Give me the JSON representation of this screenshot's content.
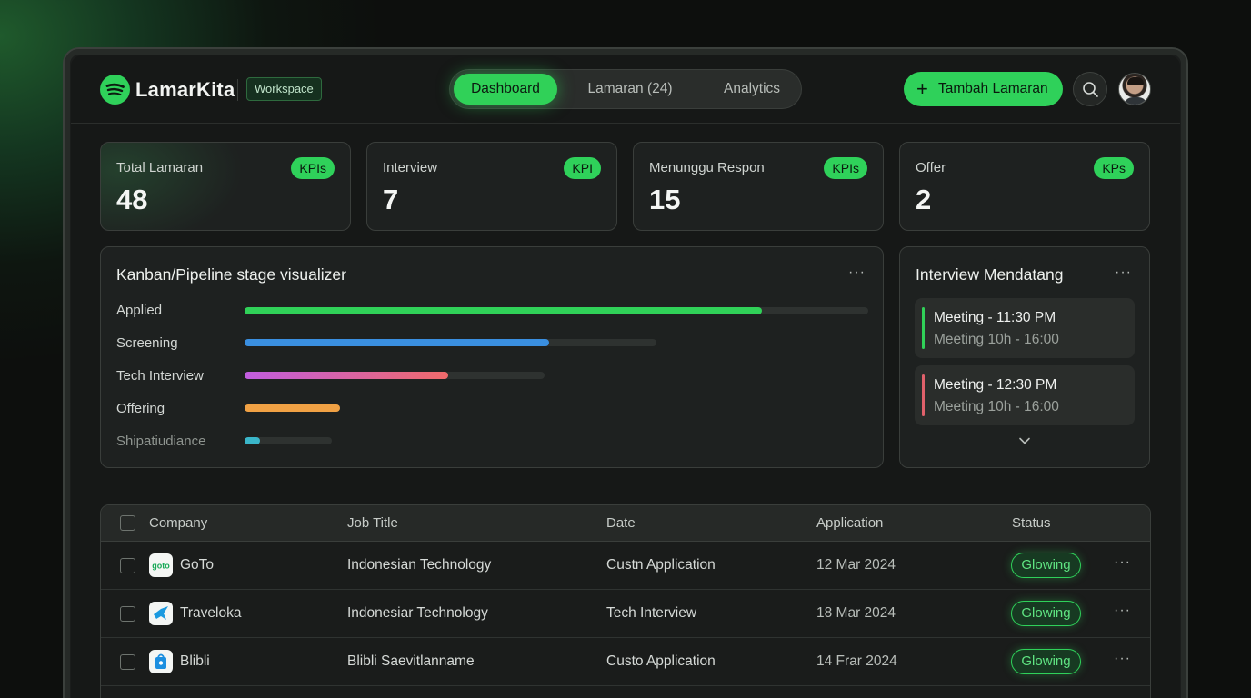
{
  "app": {
    "brand": "LamarKita",
    "workspace_badge": "Workspace"
  },
  "nav": {
    "tabs": [
      {
        "label": "Dashboard",
        "active": true
      },
      {
        "label": "Lamaran (24)",
        "active": false
      },
      {
        "label": "Analytics",
        "active": false
      }
    ],
    "add_button": "Tambah Lamaran"
  },
  "kpis": [
    {
      "label": "Total Lamaran",
      "value": "48",
      "badge": "KPIs"
    },
    {
      "label": "Interview",
      "value": "7",
      "badge": "KPI"
    },
    {
      "label": "Menunggu Respon",
      "value": "15",
      "badge": "KPIs"
    },
    {
      "label": "Offer",
      "value": "2",
      "badge": "KPs"
    }
  ],
  "pipeline": {
    "title": "Kanban/Pipeline stage visualizer",
    "more": "···",
    "stages": [
      {
        "label": "Applied",
        "fill_fraction": 0.83,
        "color": "#30d158"
      },
      {
        "label": "Screening",
        "fill_fraction": 0.74,
        "color": "#3a8fe0"
      },
      {
        "label": "Tech Interview",
        "fill_fraction": 0.68,
        "color": "#c15de0"
      },
      {
        "label": "Offering",
        "fill_fraction": 1.0,
        "color": "#f0a144"
      },
      {
        "label": "Shipatiudiance",
        "fill_fraction": 0.18,
        "color": "#3ab6c9"
      }
    ]
  },
  "interviews": {
    "title": "Interview Mendatang",
    "more": "···",
    "items": [
      {
        "title": "Meeting - 11:30 PM",
        "sub": "Meeting 10h - 16:00",
        "accent": "#30d158"
      },
      {
        "title": "Meeting - 12:30 PM",
        "sub": "Meeting 10h - 16:00",
        "accent": "#e0616b"
      }
    ]
  },
  "table": {
    "columns": [
      "Company",
      "Job Title",
      "Date",
      "Application",
      "Status"
    ],
    "rows": [
      {
        "company": "GoTo",
        "job": "Indonesian Technology",
        "date": "Custn Application",
        "application": "12 Mar 2024",
        "status": "Glowing"
      },
      {
        "company": "Traveloka",
        "job": "Indonesiar Technology",
        "date": "Tech Interview",
        "application": "18 Mar 2024",
        "status": "Glowing"
      },
      {
        "company": "Blibli",
        "job": "Blibli Saevitlanname",
        "date": "Custo Application",
        "application": "14 Frar 2024",
        "status": "Glowing"
      }
    ],
    "row_more": "···"
  },
  "icons": {
    "logo": "spotify-like-logo-icon",
    "search": "search-icon",
    "plus": "plus-icon",
    "chevron": "chevron-down-icon"
  },
  "colors": {
    "accent": "#30d158",
    "background": "#161817"
  }
}
